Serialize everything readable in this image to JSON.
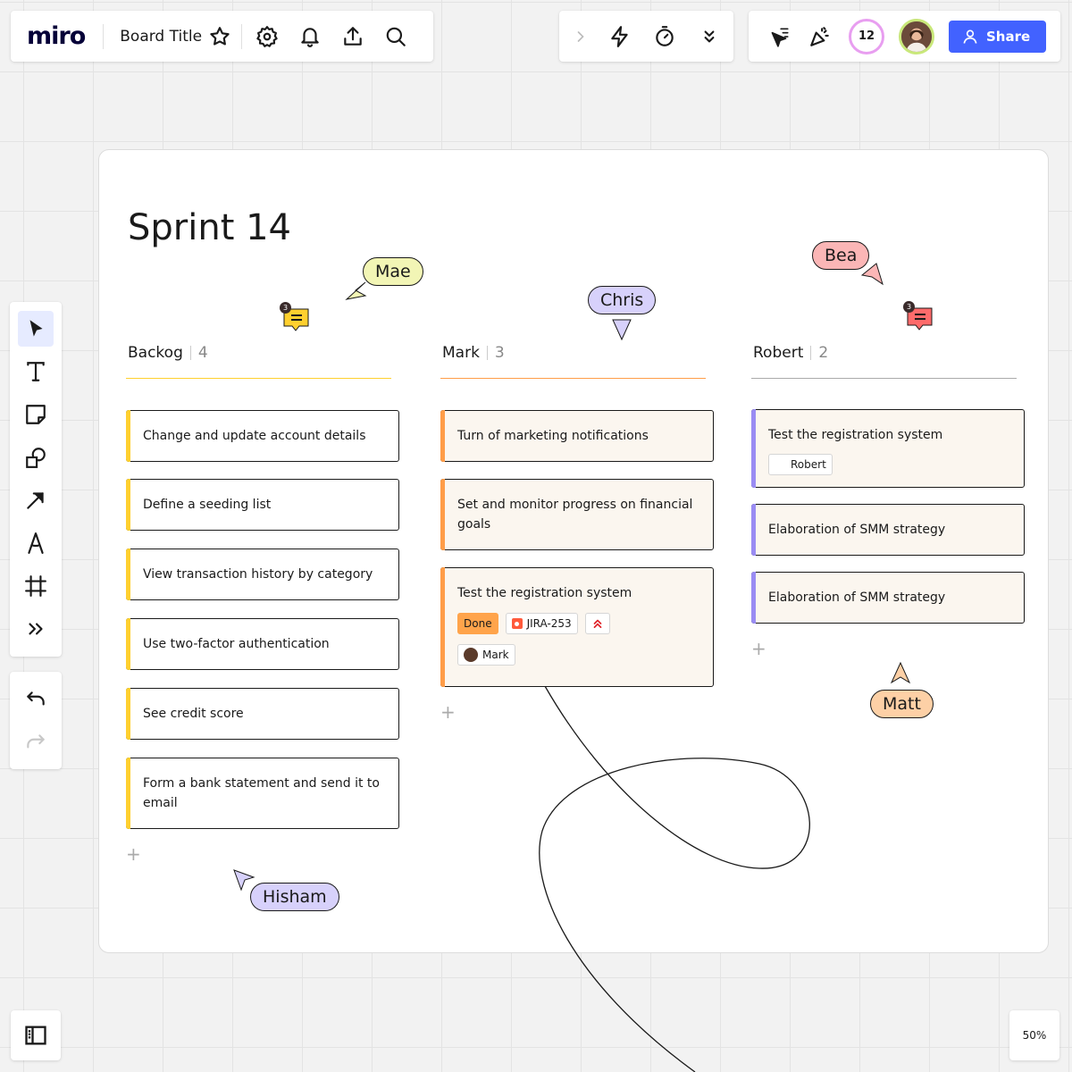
{
  "header": {
    "logo": "miro",
    "board_title": "Board Title",
    "users_count": "12",
    "share_label": "Share"
  },
  "board": {
    "title": "Sprint 14",
    "columns": [
      {
        "name": "Backog",
        "count": "4",
        "accent": "#ffd02f",
        "cards": [
          {
            "text": "Change and update account details"
          },
          {
            "text": "Define a seeding list"
          },
          {
            "text": "View transaction history by category"
          },
          {
            "text": "Use two-factor authentication"
          },
          {
            "text": "See credit score"
          },
          {
            "text": "Form a bank statement and send it to email"
          }
        ]
      },
      {
        "name": "Mark",
        "count": "3",
        "accent": "#ff9d48",
        "cards": [
          {
            "text": "Turn of marketing notifications"
          },
          {
            "text": "Set and monitor progress on financial goals"
          },
          {
            "text": "Test the registration system",
            "status": "Done",
            "ticket": "JIRA-253",
            "assignee": "Mark"
          }
        ]
      },
      {
        "name": "Robert",
        "count": "2",
        "accent": "#9a8cf3",
        "cards": [
          {
            "text": "Test the registration system",
            "assignee": "Robert"
          },
          {
            "text": "Elaboration of SMM strategy"
          },
          {
            "text": "Elaboration of SMM strategy"
          }
        ]
      }
    ],
    "comments": [
      {
        "count": "3",
        "color": "#ffd02f"
      },
      {
        "count": "3",
        "color": "#ff6b6b"
      }
    ],
    "cursors": [
      {
        "name": "Mae",
        "color": "#f2f5b5"
      },
      {
        "name": "Chris",
        "color": "#d7d1fb"
      },
      {
        "name": "Bea",
        "color": "#fbb6b6"
      },
      {
        "name": "Matt",
        "color": "#fdd0a6"
      },
      {
        "name": "Hisham",
        "color": "#d7d1fb"
      }
    ]
  },
  "footer": {
    "zoom": "50%"
  },
  "colors": {
    "brand": "#4262ff",
    "background": "#f2f2f2"
  }
}
